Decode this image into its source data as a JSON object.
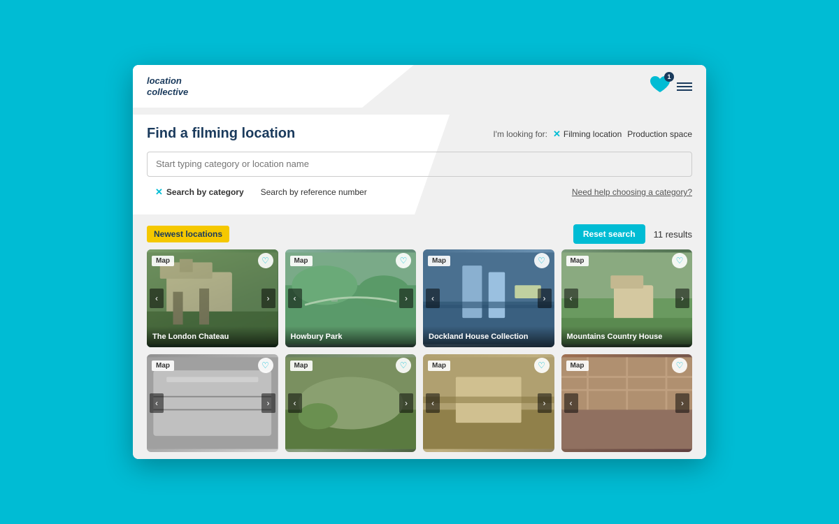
{
  "header": {
    "logo_line1": "location",
    "logo_line2": "collective",
    "heart_count": "1"
  },
  "search": {
    "title": "Find a filming location",
    "looking_for_label": "I'm looking for:",
    "filter1": "Filming location",
    "filter2": "Production space",
    "input_placeholder": "Start typing category or location name",
    "tab1": "Search by category",
    "tab2": "Search by reference number",
    "help_link": "Need help choosing a category?"
  },
  "results": {
    "badge_label": "Newest locations",
    "reset_label": "Reset search",
    "count_label": "11 results"
  },
  "cards": [
    {
      "title": "The London Chateau",
      "map_label": "Map",
      "row": 1
    },
    {
      "title": "Howbury Park",
      "map_label": "Map",
      "row": 1
    },
    {
      "title": "Dockland House Collection",
      "map_label": "Map",
      "row": 1
    },
    {
      "title": "Mountains Country House",
      "map_label": "Map",
      "row": 1
    },
    {
      "title": "",
      "map_label": "Map",
      "row": 2
    },
    {
      "title": "",
      "map_label": "Map",
      "row": 2
    },
    {
      "title": "",
      "map_label": "Map",
      "row": 2
    },
    {
      "title": "",
      "map_label": "Map",
      "row": 2
    }
  ]
}
